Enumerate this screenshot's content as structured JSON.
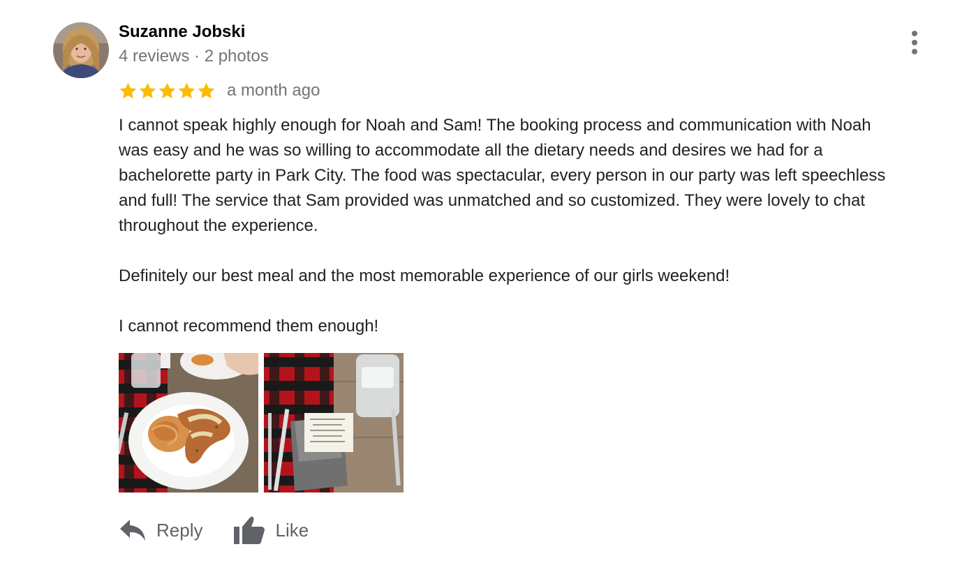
{
  "review": {
    "author": {
      "name": "Suzanne Jobski",
      "meta": "4 reviews · 2 photos"
    },
    "rating": 5,
    "date": "a month ago",
    "colors": {
      "star": "#fbbc04",
      "muted": "#70757a",
      "action": "#5f6368"
    },
    "text": {
      "paragraph1_lines": [
        "I cannot speak highly enough for Noah and Sam! The booking process and communication with Noah",
        "was easy and he was so willing to accommodate all the dietary needs and desires we had for a",
        "bachelorette party in Park City. The food was spectacular, every person in our party was left speechless",
        "and full!  The service that Sam provided was unmatched and so customized. They were lovely to chat",
        "throughout the experience."
      ],
      "paragraph2": "Definitely our best meal and the most memorable experience of our girls weekend!",
      "paragraph3": "I cannot recommend them enough!"
    },
    "photos": [
      "photo-pasta-chicken-plate",
      "photo-table-setting-menu"
    ],
    "actions": {
      "reply_label": "Reply",
      "like_label": "Like"
    },
    "icons": {
      "more": "more-vert-icon",
      "reply": "reply-arrow-icon",
      "like": "thumb-up-icon"
    }
  }
}
